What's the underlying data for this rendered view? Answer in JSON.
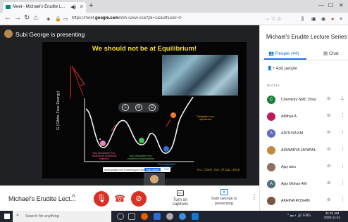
{
  "browser": {
    "tab_title": "Meet - Michael's Erudite L...",
    "new_tab": "+",
    "url_prefix": "https://meet.",
    "url_domain": "google.com",
    "url_suffix": "/xbh-caxw-xca?pli=1&authuser=0",
    "extras": "··· ♡ ☆"
  },
  "presenter_label": "Subi George is presenting",
  "slide": {
    "title": "We should not be at Equilibrium!",
    "y_axis": "G (Gibbs Free Energy)",
    "labels": {
      "non_eq_1": "Non-dissipative non-equilibrium (kinetically trapped)",
      "non_eq_2": "Non-dissipative non-equilibrium (metastable)",
      "thermo": "Thermodynamic equilibrium",
      "dissipative": "Dissipative non-equilibrium"
    },
    "citation": "Acc. Chem. Soc. of Jap., 2018",
    "share_bar_text": "meet.google.com is sharing your screen.",
    "stop_sharing": "Stop sharing",
    "hide": "Hide"
  },
  "controls": {
    "meeting_title": "Michael's Erudite Lect...",
    "captions_label": "Turn on captions",
    "presenting_label": "Subi George is presenting"
  },
  "panel": {
    "title": "Michael's Erudite Lecture Series: ...",
    "people_tab": "People (44)",
    "chat_tab": "Chat",
    "add_people": "Add people",
    "in_call": "IN CALL",
    "participants": [
      {
        "name": "Chemistry SMC (You)",
        "initial": "C",
        "color": "#188038"
      },
      {
        "name": "Adithya A",
        "initial": "",
        "color": "#c2185b"
      },
      {
        "name": "ADITHYA KM",
        "initial": "A",
        "color": "#5c6bc0"
      },
      {
        "name": "AISWARYA JAYAPAL",
        "initial": "",
        "color": "#c48a3b"
      },
      {
        "name": "Ajay alex",
        "initial": "",
        "color": "#8d6e63"
      },
      {
        "name": "Ajay Mohan AM",
        "initial": "A",
        "color": "#546e7a"
      },
      {
        "name": "AKHINA ROSHIN",
        "initial": "",
        "color": "#795548"
      }
    ]
  },
  "taskbar": {
    "search_placeholder": "Search for anything",
    "tray": "^ ▬ ◐ 🔊 ENG",
    "time": "11:21 AM",
    "date": "2020-11-21"
  }
}
